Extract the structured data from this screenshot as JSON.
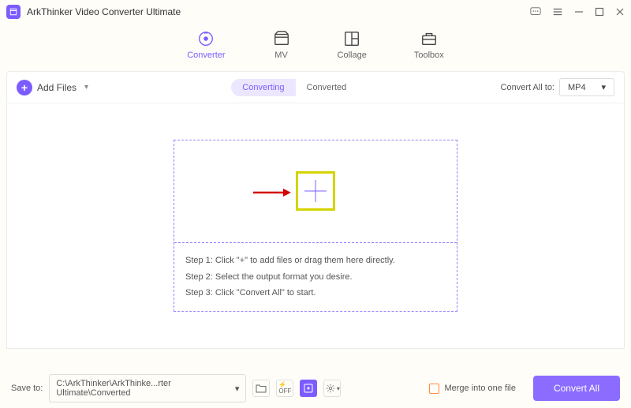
{
  "app": {
    "title": "ArkThinker Video Converter Ultimate"
  },
  "tabs": [
    {
      "label": "Converter"
    },
    {
      "label": "MV"
    },
    {
      "label": "Collage"
    },
    {
      "label": "Toolbox"
    }
  ],
  "toolbar": {
    "add_label": "Add Files",
    "seg_converting": "Converting",
    "seg_converted": "Converted",
    "convert_all_to": "Convert All to:",
    "format": "MP4"
  },
  "drop": {
    "step1": "Step 1: Click \"+\" to add files or drag them here directly.",
    "step2": "Step 2: Select the output format you desire.",
    "step3": "Step 3: Click \"Convert All\" to start."
  },
  "bottom": {
    "save_to": "Save to:",
    "path": "C:\\ArkThinker\\ArkThinke...rter Ultimate\\Converted",
    "merge_label": "Merge into one file",
    "convert_all": "Convert All"
  }
}
